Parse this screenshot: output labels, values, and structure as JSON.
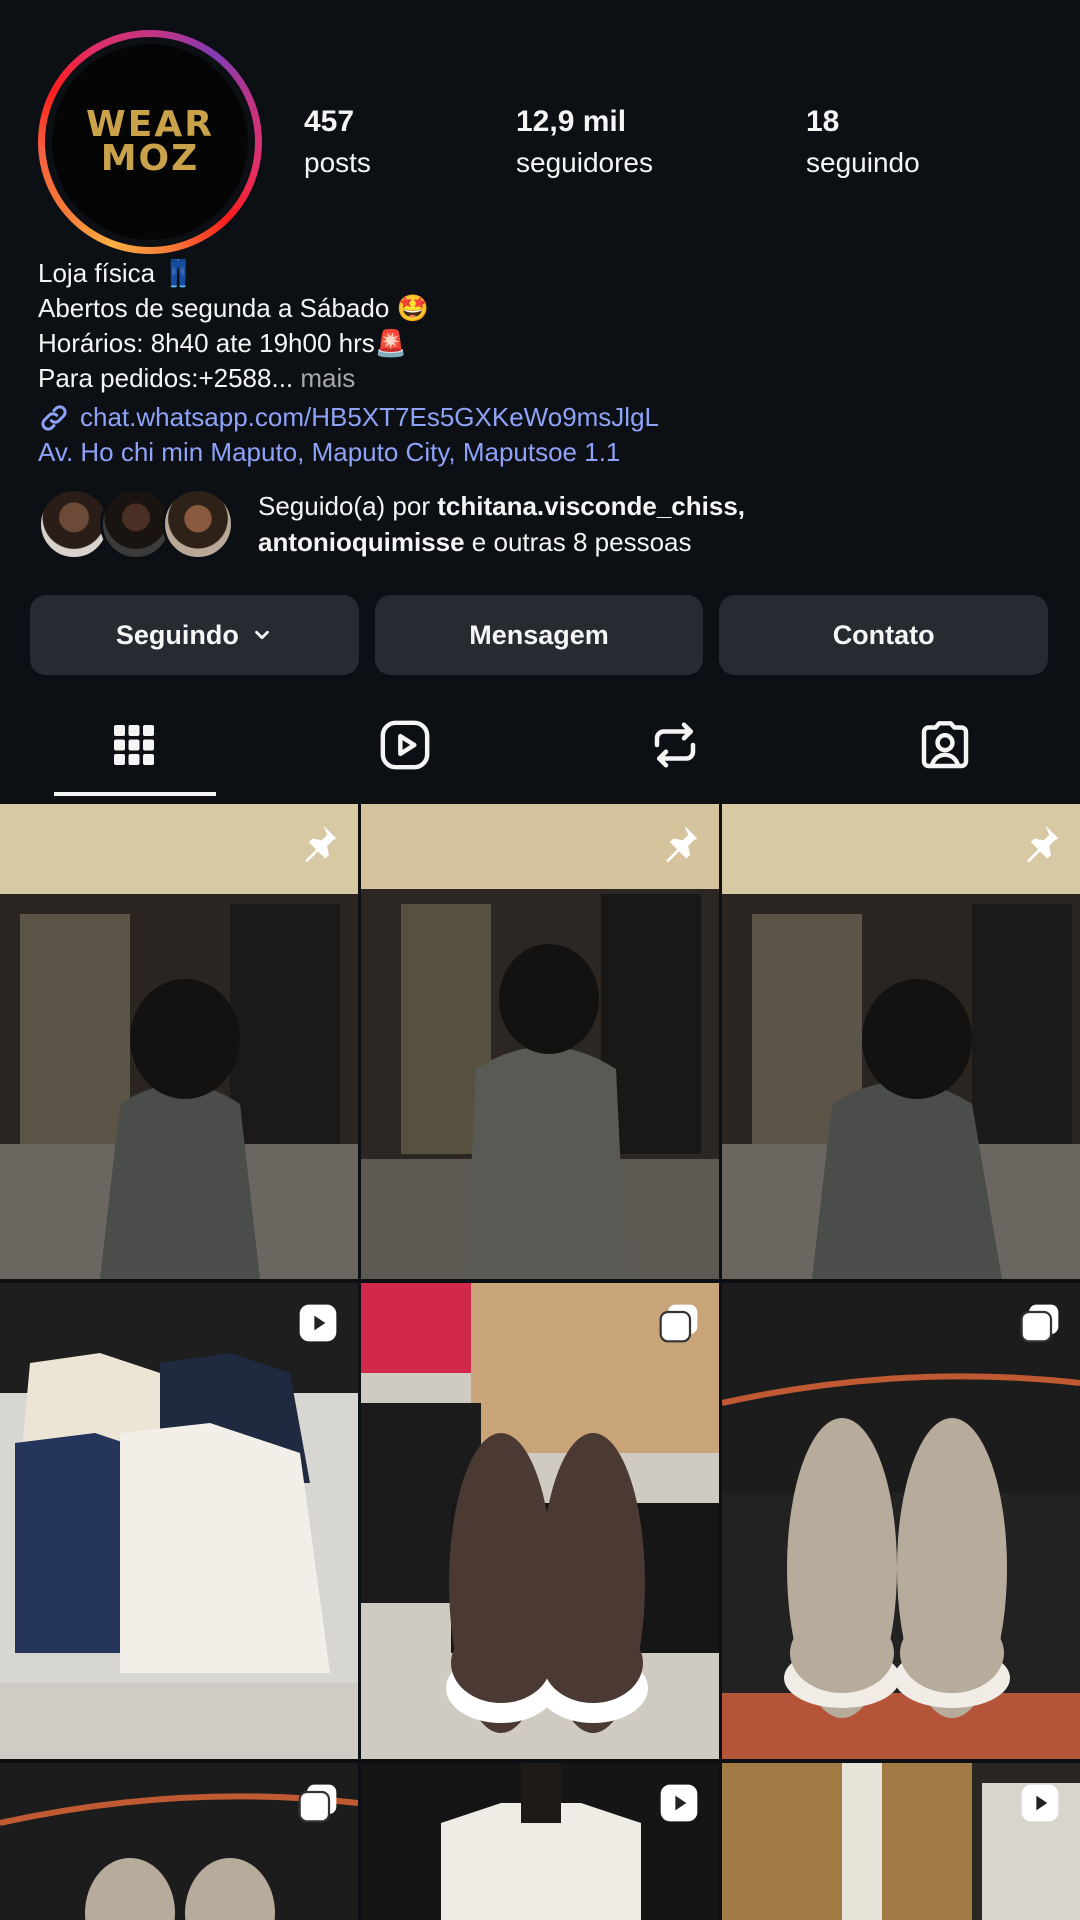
{
  "profile": {
    "avatar_text_line1": "WEAR",
    "avatar_text_line2": "MOZ",
    "stats": {
      "posts_count": "457",
      "posts_label": "posts",
      "followers_count": "12,9 mil",
      "followers_label": "seguidores",
      "following_count": "18",
      "following_label": "seguindo"
    }
  },
  "bio": {
    "line1": "Loja física 👖",
    "line2": "Abertos de segunda a Sábado 🤩",
    "line3": "Horários: 8h40 ate 19h00 hrs🚨",
    "line4_text": "Para pedidos:+2588...",
    "line4_more": " mais",
    "link": "chat.whatsapp.com/HB5XT7Es5GXKeWo9msJlgL",
    "address": "Av. Ho chi min Maputo, Maputo City, Maputsoe 1.1"
  },
  "followed_by": {
    "prefix": "Seguido(a) por ",
    "user1": "tchitana.visconde_chiss",
    "separator": ",",
    "user2": "antonioquimisse",
    "suffix": " e outras 8 pessoas"
  },
  "actions": {
    "following_label": "Seguindo",
    "message_label": "Mensagem",
    "contact_label": "Contato"
  },
  "tabs": [
    "grid-icon",
    "reels-icon",
    "reposts-icon",
    "tagged-icon"
  ],
  "posts": [
    {
      "badge": "pin-icon",
      "subject": "woman walking in store"
    },
    {
      "badge": "pin-icon",
      "subject": "woman walking in store"
    },
    {
      "badge": "pin-icon",
      "subject": "woman walking in store"
    },
    {
      "badge": "reel-icon",
      "subject": "linen shirts on hangers"
    },
    {
      "badge": "carousel-icon",
      "subject": "brown leather sneakers"
    },
    {
      "badge": "carousel-icon",
      "subject": "beige suede sneakers"
    },
    {
      "badge": "carousel-icon",
      "subject": "sneakers in box"
    },
    {
      "badge": "reel-icon",
      "subject": "white jacket on mannequin"
    },
    {
      "badge": "reel-icon",
      "subject": "tan jacket"
    }
  ],
  "colors": {
    "background": "#0c1014",
    "button": "#262b31",
    "link": "#8ea2f8",
    "avatar_gold": "#c9a24a"
  }
}
